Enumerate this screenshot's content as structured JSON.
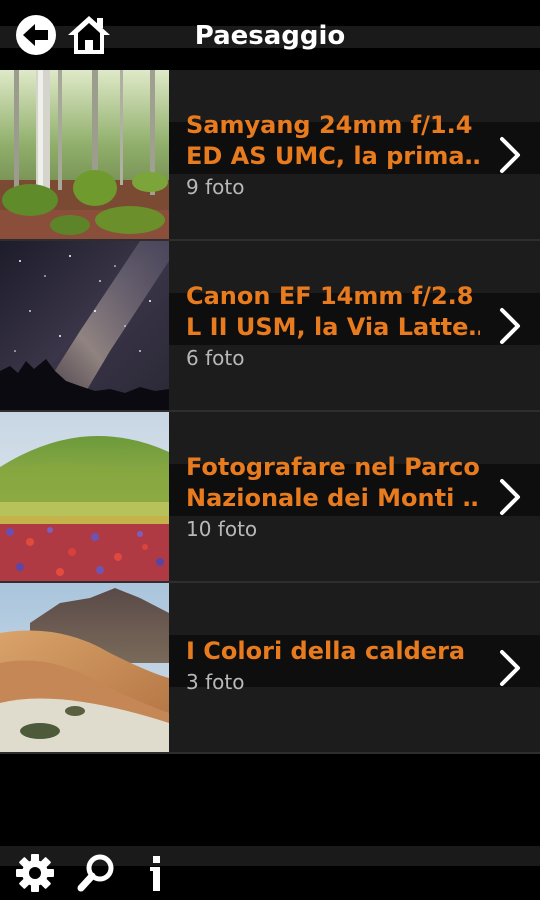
{
  "header": {
    "title": "Paesaggio",
    "back_icon": "back-arrow-icon",
    "home_icon": "home-icon"
  },
  "colors": {
    "accent": "#e87b1e",
    "row_background": "#1c1c1c",
    "count_text": "#b8b8b8"
  },
  "albums": [
    {
      "title_line1": "Samyang 24mm f/1.4",
      "title_line2": "ED AS UMC, la prima…",
      "count": "9 foto",
      "thumbnail": "forest-photo"
    },
    {
      "title_line1": "Canon EF 14mm f/2.8",
      "title_line2": "L II USM, la Via Latte…",
      "count": "6 foto",
      "thumbnail": "milky-way-photo"
    },
    {
      "title_line1": "Fotografare nel Parco",
      "title_line2": "Nazionale dei Monti …",
      "count": "10 foto",
      "thumbnail": "flower-field-photo"
    },
    {
      "title_line1": "I Colori della caldera",
      "title_line2": "",
      "count": "3 foto",
      "thumbnail": "caldera-photo"
    }
  ],
  "footer": {
    "settings_icon": "gear-icon",
    "search_icon": "search-icon",
    "info_icon": "info-icon"
  }
}
